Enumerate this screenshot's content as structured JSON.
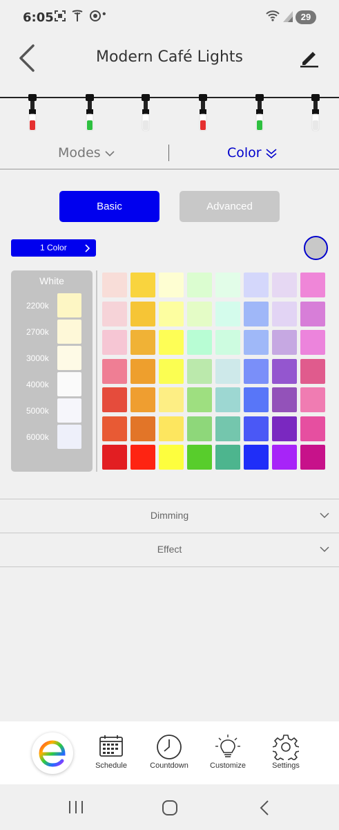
{
  "status_bar": {
    "time": "6:05",
    "left_icons": [
      "screenshot-icon",
      "tesla-icon",
      "sync-icon"
    ],
    "dot": "•",
    "battery": "29"
  },
  "header": {
    "title": "Modern Café Lights"
  },
  "strand": {
    "bulb_colors": [
      "#e53030",
      "#2ec040",
      "#e8e8e8",
      "#e53030",
      "#2ec040",
      "#e8e8e8"
    ]
  },
  "mode_tabs": {
    "modes_label": "Modes",
    "color_label": "Color",
    "active": "Color"
  },
  "segments": {
    "basic_label": "Basic",
    "advanced_label": "Advanced",
    "active": "Basic"
  },
  "color_count_label": "1 Color",
  "selected_color": "#c8c8c8",
  "white_panel": {
    "title": "White",
    "items": [
      {
        "label": "2200k",
        "color": "#fdf6c4"
      },
      {
        "label": "2700k",
        "color": "#fef8d8"
      },
      {
        "label": "3000k",
        "color": "#fefae6"
      },
      {
        "label": "4000k",
        "color": "#fafafa"
      },
      {
        "label": "5000k",
        "color": "#f6f6fb"
      },
      {
        "label": "6000k",
        "color": "#eef0fa"
      }
    ]
  },
  "palette": [
    [
      "#f8ddd8",
      "#f9d43e",
      "#fefed2",
      "#dbfdd0",
      "#e2fde8",
      "#d4d7fb",
      "#e6d8f3",
      "#ef86d8"
    ],
    [
      "#f6d3d8",
      "#f6c536",
      "#fdfea0",
      "#e4fcc6",
      "#d4fcec",
      "#9fb7f8",
      "#e2d4f4",
      "#d77ed8"
    ],
    [
      "#f6c6d4",
      "#f0b236",
      "#fefe56",
      "#b8fdd4",
      "#cdfce0",
      "#9fb8f8",
      "#c6a8e2",
      "#ec84dc"
    ],
    [
      "#ef7e94",
      "#ee9f2d",
      "#fbfe52",
      "#bbe9ac",
      "#cee9ea",
      "#7a8ff9",
      "#9456cf",
      "#e05b8d"
    ],
    [
      "#e54c3c",
      "#ef9e30",
      "#fdee84",
      "#9edf80",
      "#9dd7d2",
      "#5876f8",
      "#9352b9",
      "#f07cb2"
    ],
    [
      "#e85a34",
      "#e27528",
      "#fde65f",
      "#8ed77a",
      "#74c6ad",
      "#4a58f6",
      "#7a28c0",
      "#e64fa0"
    ],
    [
      "#e21e22",
      "#fe2412",
      "#fdfe3e",
      "#58cd2c",
      "#4db58e",
      "#1f2ef8",
      "#a724f8",
      "#c7128a"
    ]
  ],
  "accordions": [
    {
      "label": "Dimming"
    },
    {
      "label": "Effect"
    }
  ],
  "bottom_nav": {
    "items": [
      {
        "label": "Schedule",
        "icon": "calendar-icon"
      },
      {
        "label": "Countdown",
        "icon": "clock-icon"
      },
      {
        "label": "Customize",
        "icon": "lightbulb-icon"
      },
      {
        "label": "Settings",
        "icon": "gear-icon"
      }
    ]
  }
}
